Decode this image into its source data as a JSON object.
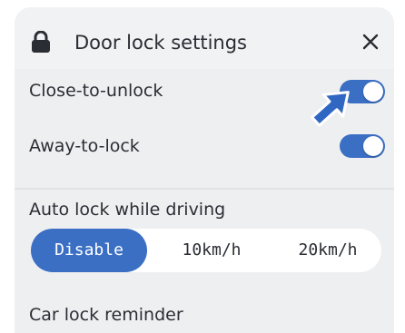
{
  "header": {
    "title": "Door lock settings",
    "lock_icon": "lock-icon",
    "close_icon": "close-icon"
  },
  "settings": {
    "close_to_unlock": {
      "label": "Close-to-unlock",
      "enabled": true
    },
    "away_to_lock": {
      "label": "Away-to-lock",
      "enabled": true
    }
  },
  "auto_lock": {
    "label": "Auto lock while driving",
    "options": [
      "Disable",
      "10km/h",
      "20km/h"
    ],
    "selected": "Disable"
  },
  "reminder": {
    "label": "Car lock reminder"
  },
  "colors": {
    "accent": "#3a6fc4",
    "panel": "#eeeff1",
    "text": "#2a2d33"
  }
}
